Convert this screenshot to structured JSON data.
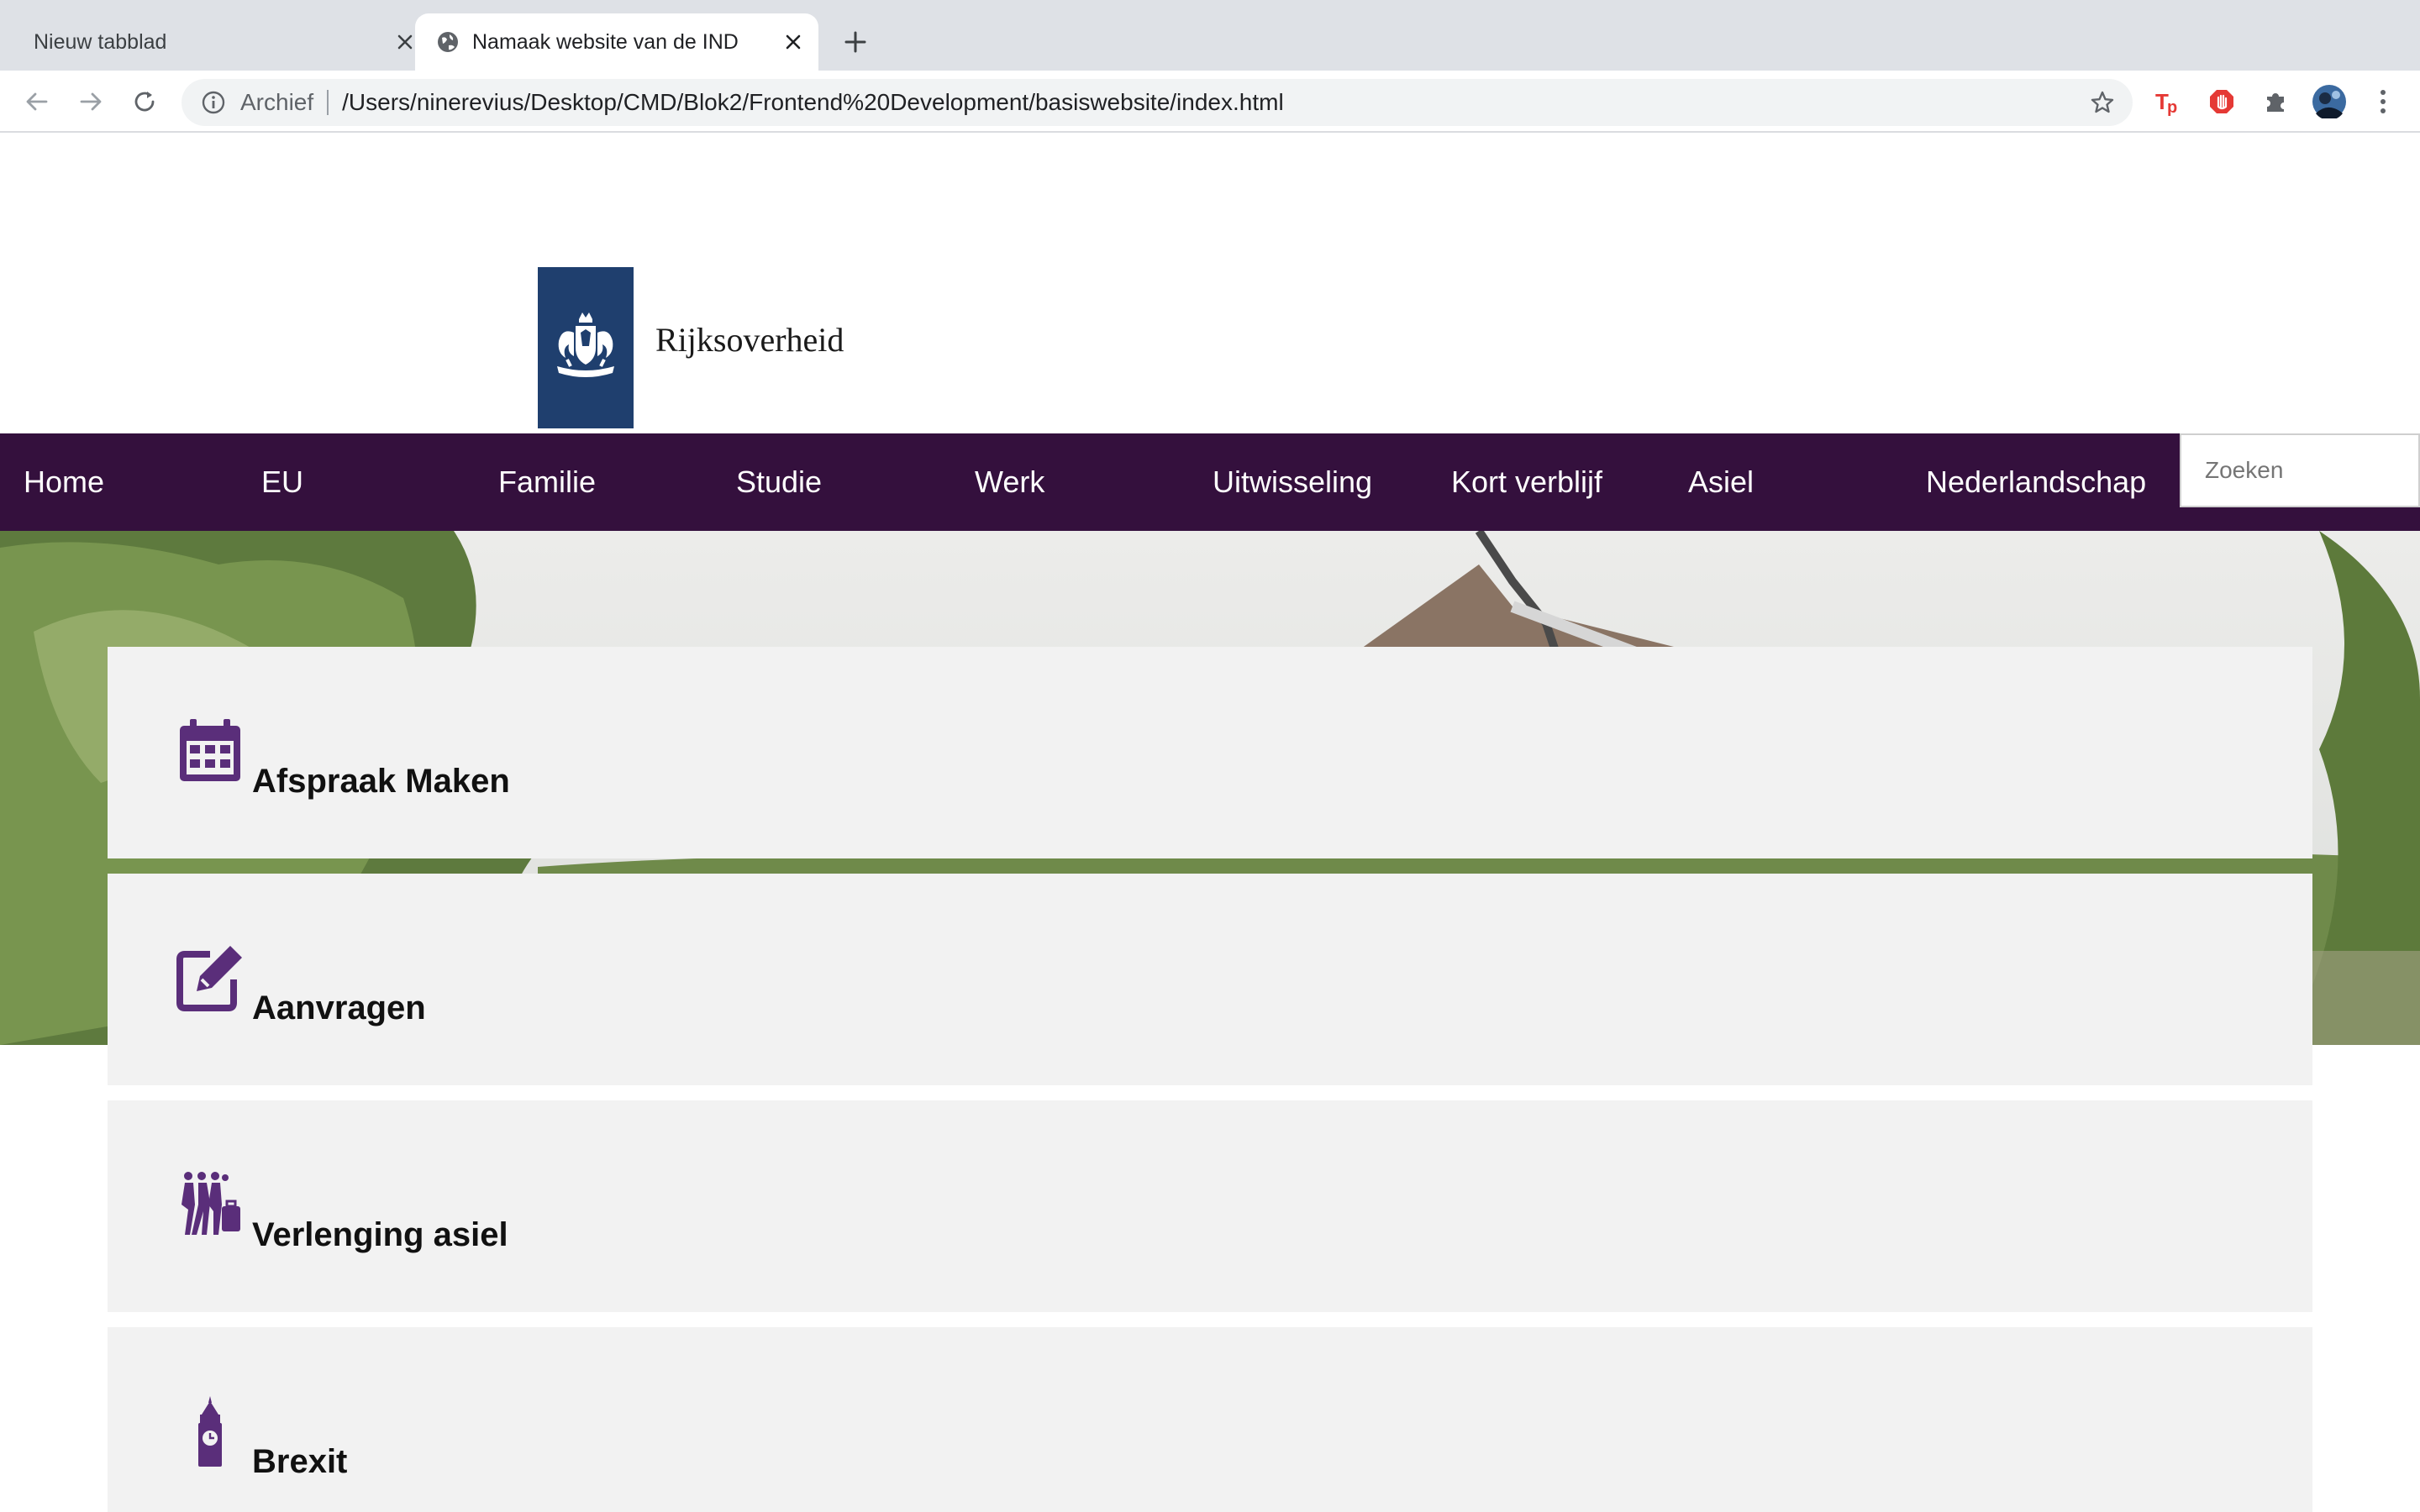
{
  "browser": {
    "tabs": [
      {
        "title": "Nieuw tabblad",
        "active": false
      },
      {
        "title": "Namaak website van de IND",
        "active": true
      }
    ],
    "omnibox": {
      "security_label": "Archief",
      "url": "/Users/ninerevius/Desktop/CMD/Blok2/Frontend%20Development/basiswebsite/index.html"
    }
  },
  "site": {
    "logo_text": "Rijksoverheid",
    "nav": [
      {
        "label": "Home"
      },
      {
        "label": "EU"
      },
      {
        "label": "Familie"
      },
      {
        "label": "Studie"
      },
      {
        "label": "Werk"
      },
      {
        "label": "Uitwisseling"
      },
      {
        "label": "Kort verblijf"
      },
      {
        "label": "Asiel"
      },
      {
        "label": "Nederlandschap"
      }
    ],
    "search_placeholder": "Zoeken",
    "cards": [
      {
        "title": "Afspraak Maken",
        "icon": "calendar-icon"
      },
      {
        "title": "Aanvragen",
        "icon": "edit-icon"
      },
      {
        "title": "Verlenging asiel",
        "icon": "travelers-icon"
      },
      {
        "title": "Brexit",
        "icon": "big-ben-icon"
      }
    ]
  },
  "colors": {
    "nav_background": "#34103d",
    "icon_purple": "#5a2e7a",
    "card_background": "#f2f2f2",
    "logo_blue": "#1f3f6e"
  }
}
